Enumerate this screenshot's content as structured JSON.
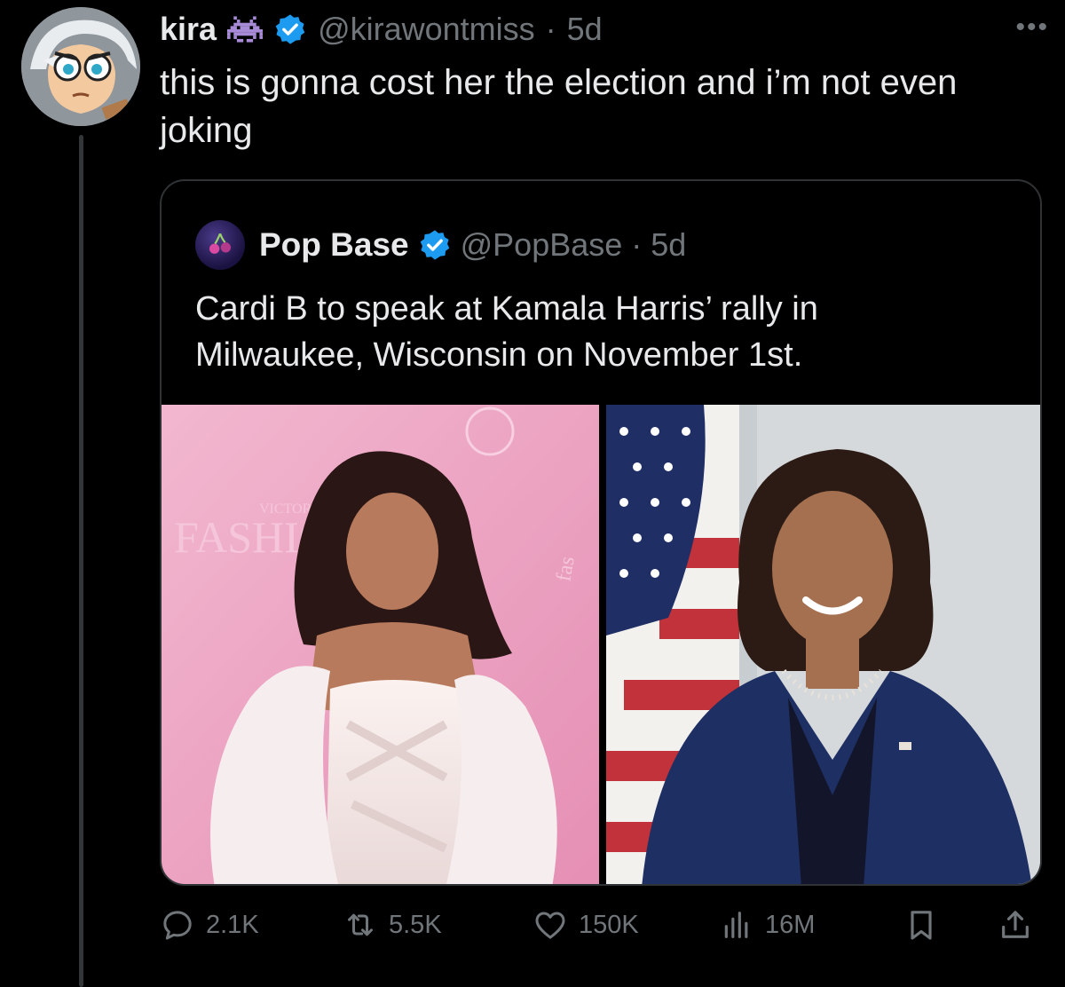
{
  "author": {
    "display_name": "kira",
    "handle": "@kirawontmiss",
    "dot": "·",
    "time": "5d",
    "badge_icon": "space-invader-icon",
    "verified_icon": "verified-badge-icon",
    "verified_color": "#1d9bf0"
  },
  "more_label": "•••",
  "tweet_text": "this is gonna cost her the election and i’m not even joking",
  "quote": {
    "display_name": "Pop Base",
    "handle": "@PopBase",
    "dot": "·",
    "time": "5d",
    "text": "Cardi B to speak at Kamala Harris’ rally in Milwaukee, Wisconsin on November 1st.",
    "media": [
      {
        "name": "cardi-b-photo",
        "sign_text": "FASHIO",
        "sign_small": "VICTORI",
        "sign_side": "fas"
      },
      {
        "name": "kamala-harris-photo"
      }
    ]
  },
  "actions": {
    "replies": "2.1K",
    "reposts": "5.5K",
    "likes": "150K",
    "views": "16M"
  },
  "colors": {
    "background": "#000000",
    "text": "#e7e9ea",
    "muted": "#71767b",
    "border": "#2f3336"
  }
}
